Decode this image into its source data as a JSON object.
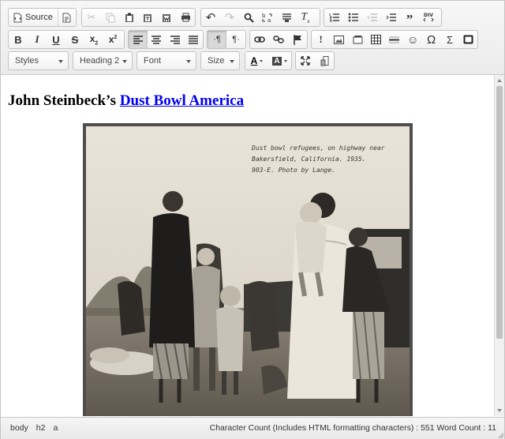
{
  "toolbar": {
    "source_label": "Source",
    "styles": {
      "label": "Styles"
    },
    "format": {
      "label": "Heading 2"
    },
    "font": {
      "label": "Font"
    },
    "size": {
      "label": "Size"
    },
    "text_color_label": "A",
    "bg_color_label": "A",
    "icons": [
      "source-icon",
      "templates-icon",
      "cut-icon",
      "copy-icon",
      "paste-icon",
      "paste-text-icon",
      "paste-word-icon",
      "print-icon",
      "undo-icon",
      "redo-icon",
      "find-icon",
      "replace-icon",
      "select-all-icon",
      "remove-format-icon",
      "numbered-list-icon",
      "bulleted-list-icon",
      "outdent-icon",
      "indent-icon",
      "blockquote-icon",
      "div-icon",
      "bold-icon",
      "italic-icon",
      "underline-icon",
      "strike-icon",
      "subscript-icon",
      "superscript-icon",
      "align-left-icon",
      "align-center-icon",
      "align-right-icon",
      "justify-icon",
      "ltr-icon",
      "rtl-icon",
      "link-icon",
      "unlink-icon",
      "anchor-icon",
      "info-icon",
      "image-icon",
      "flash-icon",
      "table-icon",
      "horizontal-rule-icon",
      "smiley-icon",
      "special-char-icon",
      "sum-icon",
      "iframe-icon",
      "maximize-icon",
      "show-blocks-icon"
    ]
  },
  "content": {
    "heading_prefix": "John Steinbeck’s ",
    "heading_link": "Dust Bowl America",
    "photo_caption_lines": [
      "Dust bowl refugees, on highway near",
      "Bakersfield, California. 1935.",
      "903-E. Photo by Lange."
    ]
  },
  "statusbar": {
    "path": [
      "body",
      "h2",
      "a"
    ],
    "count_text": "Character Count (Includes HTML formatting characters) : 551 Word Count : 11"
  },
  "colors": {
    "link": "#0000ee",
    "toolbar_bg": "#ebebeb",
    "photo_frame": "#4e4e4e"
  }
}
